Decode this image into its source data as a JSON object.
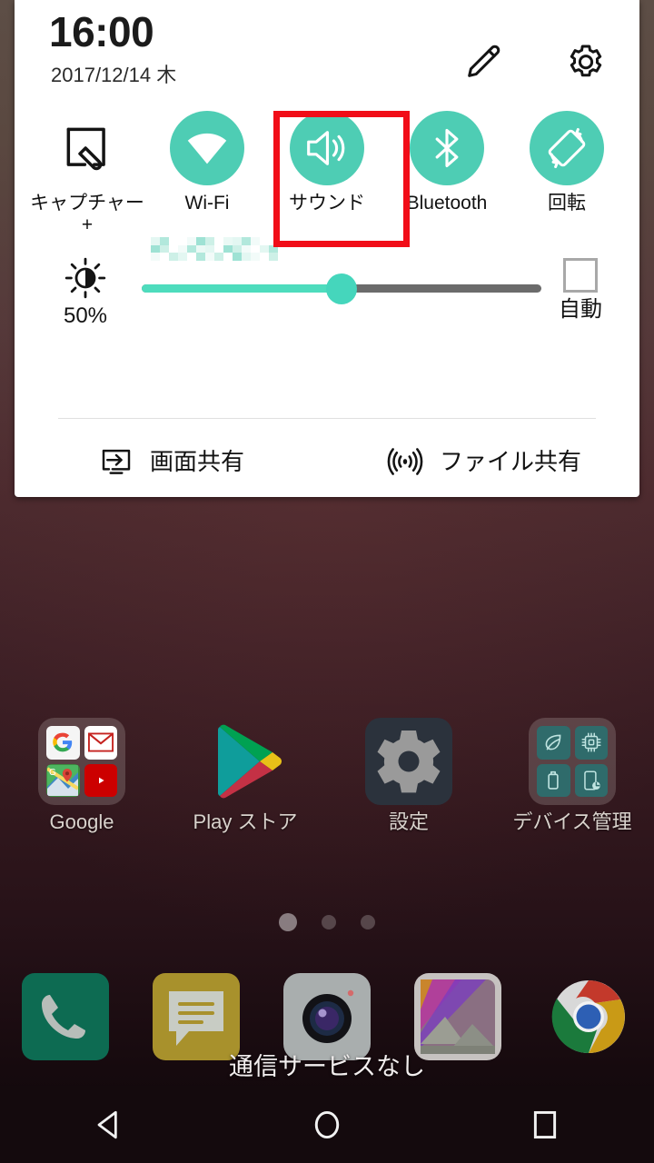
{
  "status": {
    "toast": "通信サービスなし"
  },
  "quick_settings": {
    "clock": "16:00",
    "date": "2017/12/14 木",
    "header_icons": [
      {
        "name": "edit-pencil-icon",
        "label": "編集"
      },
      {
        "name": "settings-gear-icon",
        "label": "設定"
      }
    ],
    "toggles": [
      {
        "id": "capture-plus",
        "label": "キャプチャー+",
        "state": "off",
        "icon": "capture-pen-icon"
      },
      {
        "id": "wifi",
        "label": "Wi-Fi",
        "state": "on",
        "icon": "wifi-icon"
      },
      {
        "id": "sound",
        "label": "サウンド",
        "state": "on",
        "icon": "volume-speaker-icon",
        "highlighted": true
      },
      {
        "id": "bluetooth",
        "label": "Bluetooth",
        "state": "on",
        "icon": "bluetooth-icon"
      },
      {
        "id": "rotation",
        "label": "回転",
        "state": "on",
        "icon": "screen-rotation-icon"
      }
    ],
    "ssid_redacted": "",
    "brightness": {
      "icon": "brightness-icon",
      "percent_label": "50%",
      "value": 50,
      "auto_label": "自動",
      "auto_checked": false
    },
    "share_items": [
      {
        "id": "screen-share",
        "label": "画面共有",
        "icon": "screen-share-icon"
      },
      {
        "id": "file-share",
        "label": "ファイル共有",
        "icon": "file-share-icon"
      }
    ],
    "colors": {
      "accent_teal": "#4ecdb4",
      "highlight_red": "#f10d18",
      "slider_track": "#6b6b6b"
    }
  },
  "home": {
    "apps": [
      {
        "id": "google-folder",
        "label": "Google",
        "type": "folder"
      },
      {
        "id": "play-store",
        "label": "Play ストア",
        "type": "app"
      },
      {
        "id": "settings",
        "label": "設定",
        "type": "app"
      },
      {
        "id": "device-manager",
        "label": "デバイス管理",
        "type": "folder"
      }
    ],
    "page_dots": {
      "count": 3,
      "active_index": 0
    },
    "dock": [
      {
        "id": "phone",
        "label": "電話"
      },
      {
        "id": "messages",
        "label": "メッセージ"
      },
      {
        "id": "camera",
        "label": "カメラ"
      },
      {
        "id": "gallery",
        "label": "ギャラリー"
      },
      {
        "id": "chrome",
        "label": "Chrome"
      }
    ]
  },
  "navbar": {
    "buttons": [
      {
        "id": "back",
        "label": "戻る",
        "icon": "back-triangle-icon"
      },
      {
        "id": "home",
        "label": "ホーム",
        "icon": "home-circle-icon"
      },
      {
        "id": "recents",
        "label": "履歴",
        "icon": "recents-square-icon"
      }
    ]
  }
}
